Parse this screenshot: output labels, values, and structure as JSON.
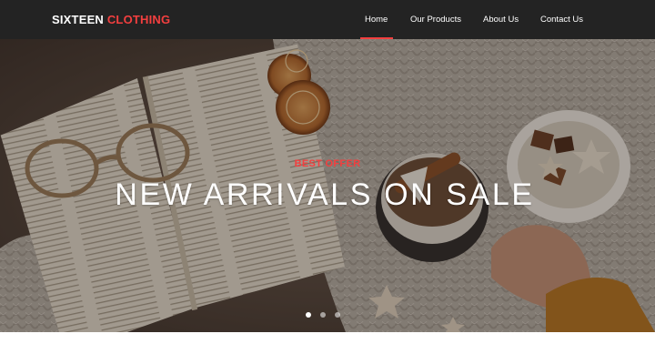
{
  "brand": {
    "primary": "SIXTEEN",
    "accent": "CLOTHING"
  },
  "nav": {
    "items": [
      {
        "label": "Home",
        "active": true
      },
      {
        "label": "Our Products",
        "active": false
      },
      {
        "label": "About Us",
        "active": false
      },
      {
        "label": "Contact Us",
        "active": false
      }
    ]
  },
  "hero": {
    "kicker": "BEST OFFER",
    "headline": "NEW ARRIVALS ON SALE",
    "slides": {
      "count": 3,
      "active_index": 0
    }
  },
  "colors": {
    "navbar_bg": "#232323",
    "accent_red": "#f33f3f",
    "text_white": "#ffffff"
  }
}
